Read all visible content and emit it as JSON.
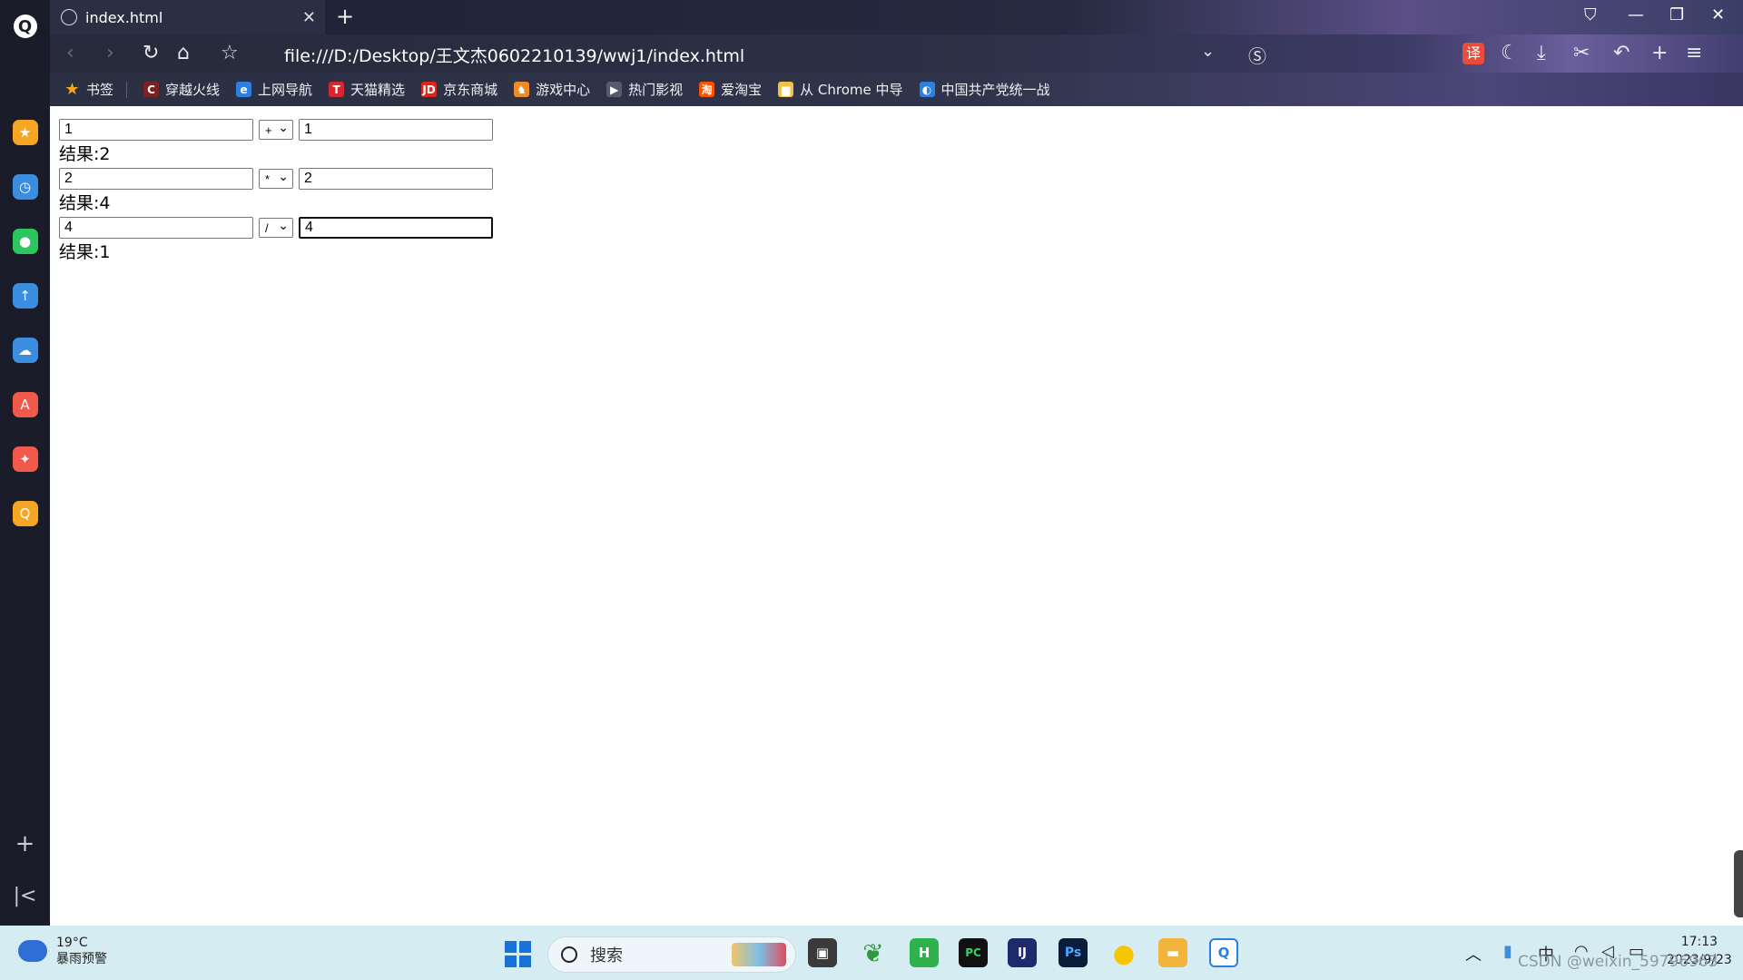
{
  "browser": {
    "tab_title": "index.html",
    "address": "file:///D:/Desktop/王文杰0602210139/wwj1/index.html",
    "bookmarks": [
      {
        "label": "书签",
        "color": "#f5a623",
        "glyph": "★"
      },
      {
        "label": "穿越火线",
        "color": "#7a2222",
        "glyph": "C"
      },
      {
        "label": "上网导航",
        "color": "#2d7fe0",
        "glyph": "e"
      },
      {
        "label": "天猫精选",
        "color": "#d7262d",
        "glyph": "T"
      },
      {
        "label": "京东商城",
        "color": "#e1251b",
        "glyph": "JD"
      },
      {
        "label": "游戏中心",
        "color": "#f08a24",
        "glyph": "♞"
      },
      {
        "label": "热门影视",
        "color": "#555a6e",
        "glyph": "▶"
      },
      {
        "label": "爱淘宝",
        "color": "#ff5000",
        "glyph": "淘"
      },
      {
        "label": "从 Chrome 中导",
        "color": "#f3c244",
        "glyph": "▆"
      },
      {
        "label": "中国共产党统一战",
        "color": "#2d7fe0",
        "glyph": "◐"
      }
    ],
    "translate_badge": "译"
  },
  "calculator": [
    {
      "left": "1",
      "op": "+",
      "right": "1",
      "result": "结果:2"
    },
    {
      "left": "2",
      "op": "*",
      "right": "2",
      "result": "结果:4"
    },
    {
      "left": "4",
      "op": "/",
      "right": "4",
      "result": "结果:1"
    }
  ],
  "taskbar": {
    "weather_temp": "19°C",
    "weather_alert": "暴雨预警",
    "search_label": "搜索",
    "tray_ime": "中",
    "time": "17:13",
    "date": "2023/9/23",
    "watermark": "CSDN @weixin_59796963"
  },
  "sidebar_apps": [
    {
      "name": "favorites-app",
      "color": "#f5a623",
      "glyph": "★"
    },
    {
      "name": "clock-app",
      "color": "#3b8de0",
      "glyph": "◷"
    },
    {
      "name": "wechat-app",
      "color": "#2dc55e",
      "glyph": "●"
    },
    {
      "name": "upload-app",
      "color": "#3b8de0",
      "glyph": "↑"
    },
    {
      "name": "cloud-app",
      "color": "#3b8de0",
      "glyph": "☁"
    },
    {
      "name": "translate-app",
      "color": "#f05a4a",
      "glyph": "A"
    },
    {
      "name": "pdf-app",
      "color": "#f05a4a",
      "glyph": "✦"
    },
    {
      "name": "search-app",
      "color": "#f5a623",
      "glyph": "Q"
    }
  ]
}
